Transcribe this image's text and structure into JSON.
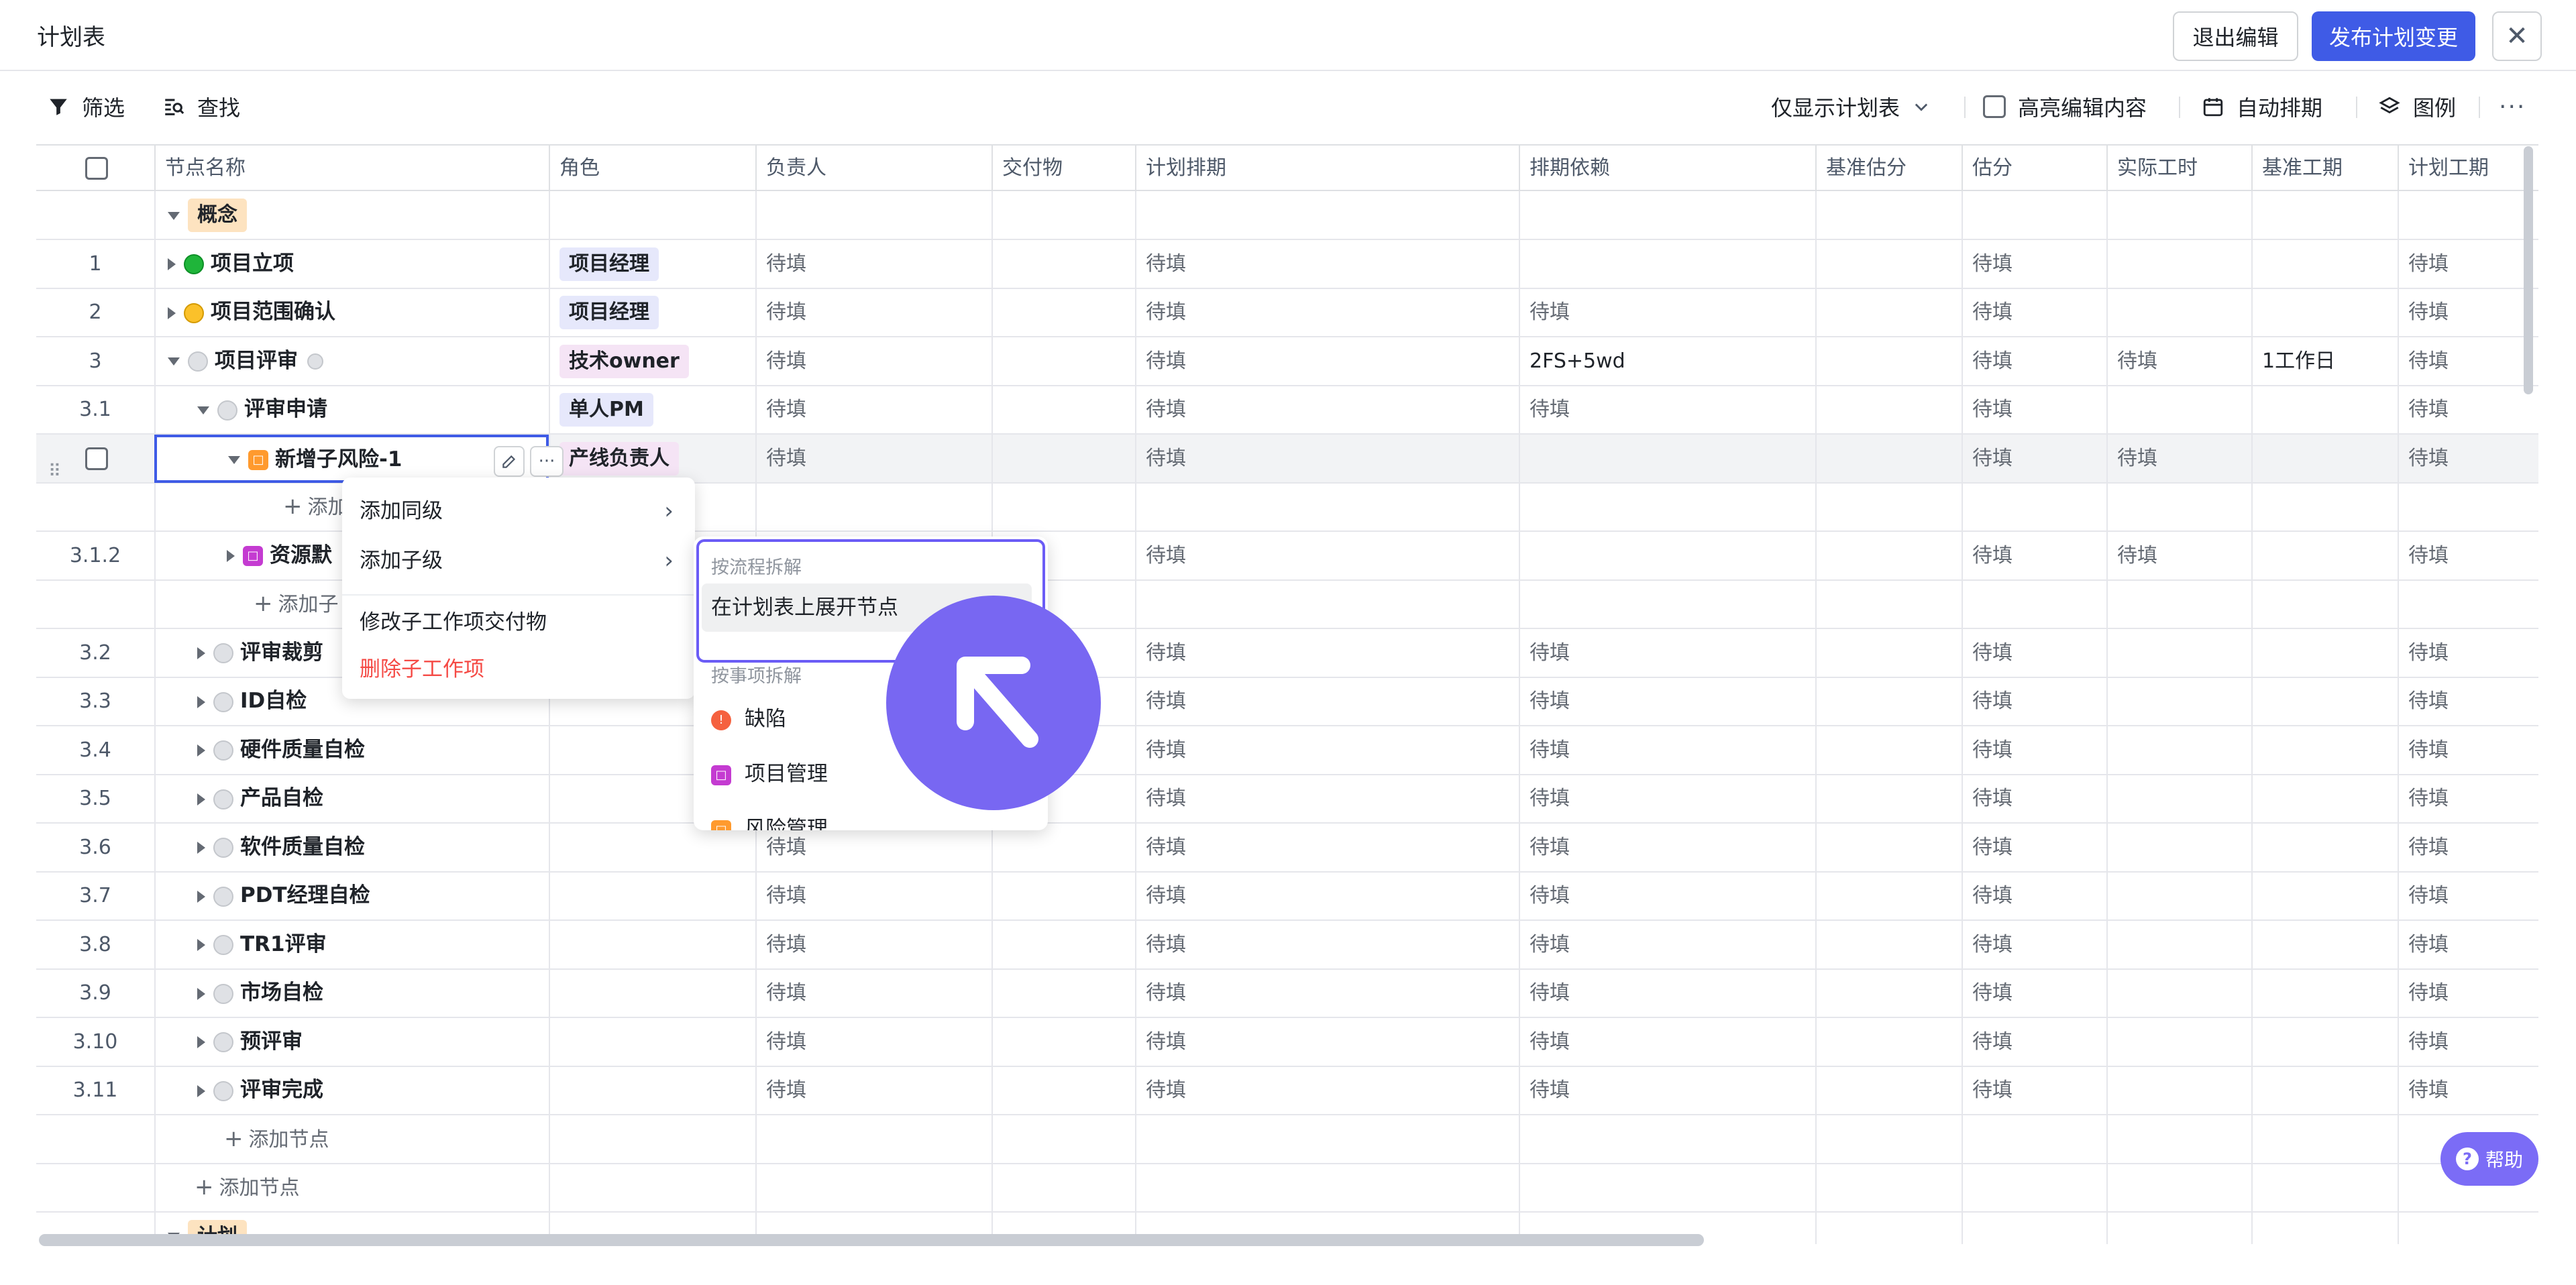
{
  "header": {
    "title": "计划表",
    "exit_label": "退出编辑",
    "publish_label": "发布计划变更",
    "close_label": "✕"
  },
  "toolbar": {
    "filter_label": "筛选",
    "find_label": "查找",
    "view_label": "仅显示计划表",
    "highlight_label": "高亮编辑内容",
    "autoschedule_label": "自动排期",
    "legend_label": "图例",
    "more_label": "···"
  },
  "columns": [
    "节点名称",
    "角色",
    "负责人",
    "交付物",
    "计划排期",
    "排期依赖",
    "基准估分",
    "估分",
    "实际工时",
    "基准工期",
    "计划工期"
  ],
  "pending": "待填",
  "rows": [
    {
      "num": "",
      "name": "概念",
      "tag": true
    },
    {
      "num": "1",
      "name": "项目立项",
      "role": "项目经理"
    },
    {
      "num": "2",
      "name": "项目范围确认",
      "role": "项目经理"
    },
    {
      "num": "3",
      "name": "项目评审",
      "role": "技术owner",
      "dependency": "2FS+5wd",
      "actual": "待填",
      "baseline_duration": "1工作日"
    },
    {
      "num": "3.1",
      "name": "评审申请",
      "role": "单人PM"
    },
    {
      "num": "",
      "name": "新增子风险-1",
      "role": "产线负责人",
      "actual": "待填"
    },
    {
      "num": "",
      "name": "添加"
    },
    {
      "num": "3.1.2",
      "name": "资源默",
      "actual": "待填"
    },
    {
      "num": "",
      "name": "添加子"
    },
    {
      "num": "3.2",
      "name": "评审裁剪"
    },
    {
      "num": "3.3",
      "name": "ID自检"
    },
    {
      "num": "3.4",
      "name": "硬件质量自检"
    },
    {
      "num": "3.5",
      "name": "产品自检"
    },
    {
      "num": "3.6",
      "name": "软件质量自检"
    },
    {
      "num": "3.7",
      "name": "PDT经理自检"
    },
    {
      "num": "3.8",
      "name": "TR1评审"
    },
    {
      "num": "3.9",
      "name": "市场自检"
    },
    {
      "num": "3.10",
      "name": "预评审"
    },
    {
      "num": "3.11",
      "name": "评审完成"
    },
    {
      "num": "",
      "name": "添加节点"
    },
    {
      "num": "",
      "name": "添加节点"
    },
    {
      "num": "",
      "name": "计划",
      "tag": true
    }
  ],
  "context_menu": {
    "add_sibling": "添加同级",
    "add_child": "添加子级",
    "modify_deliverable": "修改子工作项交付物",
    "delete_item": "删除子工作项"
  },
  "submenu": {
    "section_process": "按流程拆解",
    "expand_node": "在计划表上展开节点",
    "section_items": "按事项拆解",
    "item_defect": "缺陷",
    "item_project": "项目管理",
    "item_risk": "风险管理"
  },
  "help_label": "帮助"
}
